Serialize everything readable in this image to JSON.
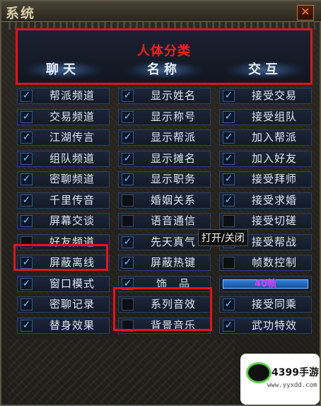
{
  "window": {
    "title": "系统",
    "close_icon": "close-x-icon"
  },
  "category": {
    "title": "人体分类",
    "tabs": [
      "聊天",
      "名称",
      "交互"
    ]
  },
  "tooltip": "打开/关闭",
  "options": {
    "col1": [
      {
        "label": "帮派频道",
        "checked": true
      },
      {
        "label": "交易频道",
        "checked": true
      },
      {
        "label": "江湖传言",
        "checked": true
      },
      {
        "label": "组队频道",
        "checked": true
      },
      {
        "label": "密聊频道",
        "checked": true
      },
      {
        "label": "千里传音",
        "checked": true
      },
      {
        "label": "屏幕交谈",
        "checked": true
      },
      {
        "label": "好友频道",
        "checked": false
      },
      {
        "label": "屏蔽离线",
        "checked": true
      },
      {
        "label": "窗口模式",
        "checked": true
      },
      {
        "label": "密聊记录",
        "checked": true
      },
      {
        "label": "替身效果",
        "checked": true
      }
    ],
    "col2": [
      {
        "label": "显示姓名",
        "checked": true
      },
      {
        "label": "显示称号",
        "checked": true
      },
      {
        "label": "显示帮派",
        "checked": true
      },
      {
        "label": "显示摊名",
        "checked": true
      },
      {
        "label": "显示职务",
        "checked": true
      },
      {
        "label": "婚姻关系",
        "checked": false
      },
      {
        "label": "语音通信",
        "checked": false
      },
      {
        "label": "先天真气",
        "checked": true
      },
      {
        "label": "屏蔽热键",
        "checked": true
      },
      {
        "label": "饰　品",
        "checked": true
      },
      {
        "label": "系列音效",
        "checked": false
      },
      {
        "label": "背景音乐",
        "checked": false
      }
    ],
    "col3": [
      {
        "label": "接受交易",
        "checked": true
      },
      {
        "label": "接受组队",
        "checked": true
      },
      {
        "label": "加入帮派",
        "checked": true
      },
      {
        "label": "加入好友",
        "checked": true
      },
      {
        "label": "接受拜师",
        "checked": true
      },
      {
        "label": "接受求婚",
        "checked": true
      },
      {
        "label": "接受切磋",
        "checked": false
      },
      {
        "label": "接受帮战",
        "checked": true
      },
      {
        "label": "帧数控制",
        "checked": false
      },
      {
        "label": "40帧",
        "checked": null,
        "type": "slider"
      },
      {
        "label": "接受同乘",
        "checked": true
      },
      {
        "label": "武功特效",
        "checked": true
      }
    ]
  },
  "watermark": {
    "brand": "4399手游",
    "url": "www.yyxdd.com"
  },
  "colors": {
    "highlight": "#e0141e",
    "check": "#6ec0ff",
    "fps_text": "#e23bff"
  }
}
